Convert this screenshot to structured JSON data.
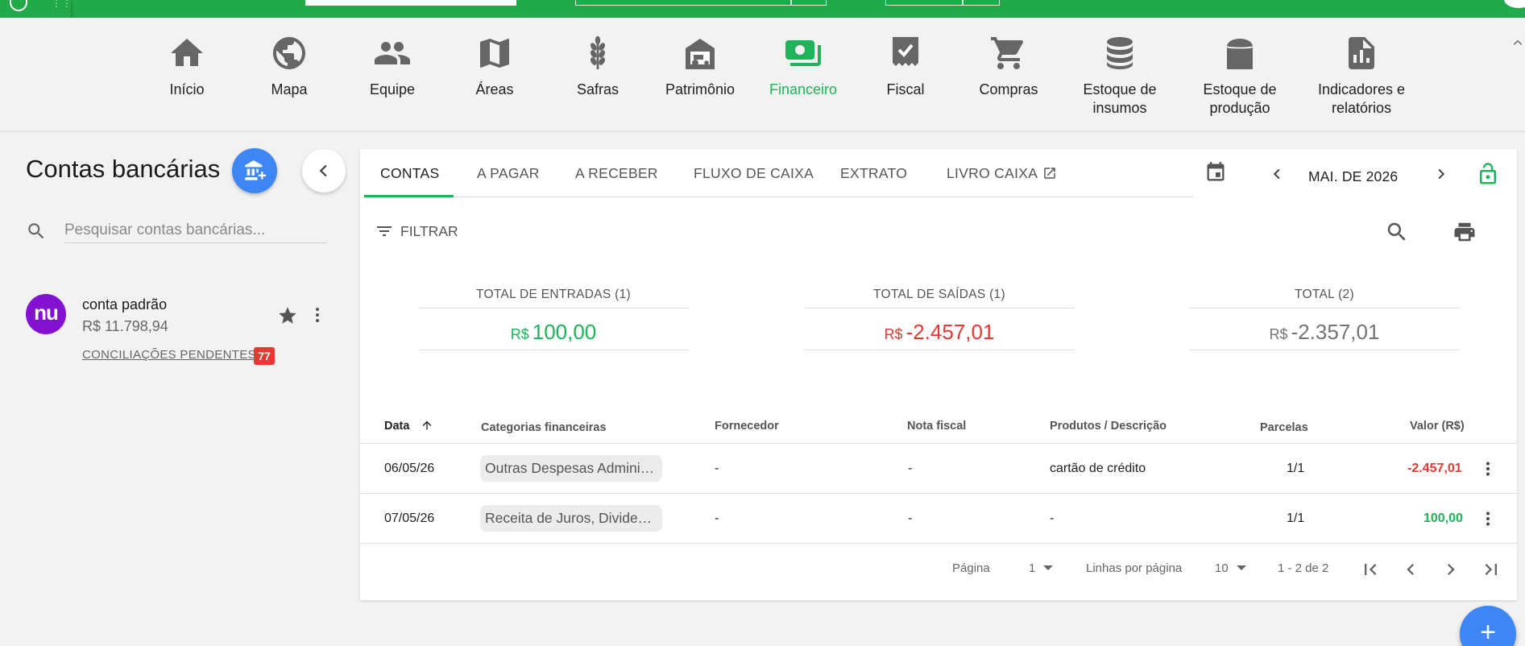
{
  "nav": {
    "items": [
      {
        "label": "Início",
        "icon": "home-icon"
      },
      {
        "label": "Mapa",
        "icon": "globe-icon"
      },
      {
        "label": "Equipe",
        "icon": "people-icon"
      },
      {
        "label": "Áreas",
        "icon": "map-icon"
      },
      {
        "label": "Safras",
        "icon": "wheat-icon"
      },
      {
        "label": "Patrimônio",
        "icon": "barn-tractor-icon"
      },
      {
        "label": "Financeiro",
        "icon": "money-icon"
      },
      {
        "label": "Fiscal",
        "icon": "invoice-icon"
      },
      {
        "label": "Compras",
        "icon": "cart-icon"
      },
      {
        "label": "Estoque de insumos",
        "icon": "database-icon"
      },
      {
        "label": "Estoque de produção",
        "icon": "silo-icon"
      },
      {
        "label": "Indicadores e relatórios",
        "icon": "report-icon"
      }
    ],
    "active": "Financeiro"
  },
  "left": {
    "title": "Contas bancárias",
    "search_placeholder": "Pesquisar contas bancárias...",
    "account": {
      "avatar_text": "nu",
      "name": "conta padrão",
      "balance": "R$ 11.798,94",
      "pending_label": "CONCILIAÇÕES PENDENTES",
      "pending_count": "77"
    }
  },
  "tabs": [
    "CONTAS",
    "A PAGAR",
    "A RECEBER",
    "FLUXO DE CAIXA",
    "EXTRATO",
    "LIVRO CAIXA"
  ],
  "month_label": "MAI. DE 2026",
  "filter_label": "FILTRAR",
  "totals": [
    {
      "label": "TOTAL DE ENTRADAS (1)",
      "currency": "R$",
      "value": "100,00",
      "color": "#1db45a"
    },
    {
      "label": "TOTAL DE SAÍDAS (1)",
      "currency": "R$",
      "value": "-2.457,01",
      "color": "#e53935"
    },
    {
      "label": "TOTAL (2)",
      "currency": "R$",
      "value": "-2.357,01",
      "color": "#757575"
    }
  ],
  "table": {
    "headers": [
      "Data",
      "Categorias financeiras",
      "Fornecedor",
      "Nota fiscal",
      "Produtos / Descrição",
      "Parcelas",
      "Valor (R$)"
    ],
    "rows": [
      {
        "data": "06/05/26",
        "categoria": "Outras Despesas Administrativas",
        "fornecedor": "-",
        "nota": "-",
        "descricao": "cartão de crédito",
        "parcelas": "1/1",
        "valor": "-2.457,01"
      },
      {
        "data": "07/05/26",
        "categoria": "Receita de Juros, Dividendos",
        "fornecedor": "-",
        "nota": "-",
        "descricao": "-",
        "parcelas": "1/1",
        "valor": "100,00"
      }
    ]
  },
  "footer": {
    "page_label": "Página",
    "page_value": "1",
    "rows_label": "Linhas por página",
    "rows_value": "10",
    "range": "1 - 2 de 2"
  },
  "fab_label": "+"
}
